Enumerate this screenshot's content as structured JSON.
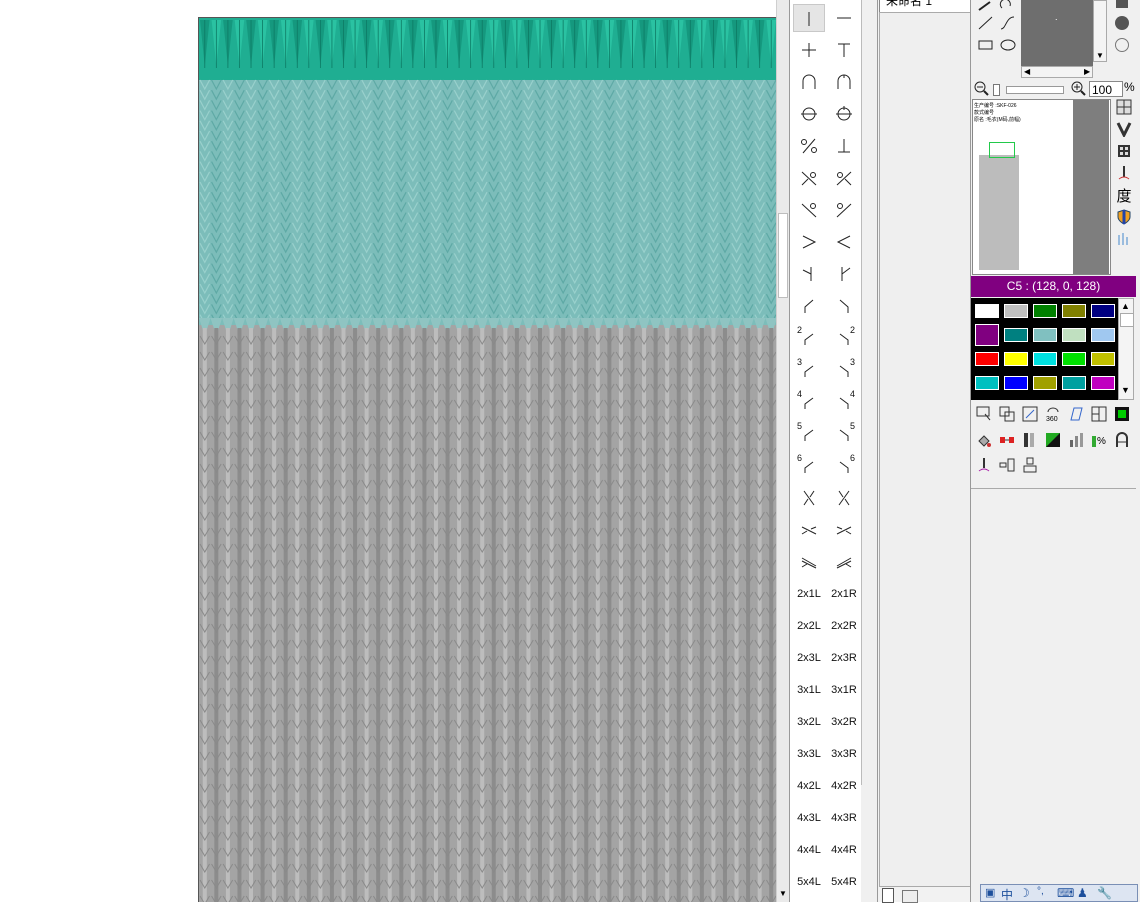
{
  "file_tab": {
    "title": "未命名 1"
  },
  "symbols": {
    "text_items": [
      "2x1L",
      "2x1R",
      "2x2L",
      "2x2R",
      "2x3L",
      "2x3R",
      "3x1L",
      "3x1R",
      "3x2L",
      "3x2R",
      "3x3L",
      "3x3R",
      "4x2L",
      "4x2R",
      "4x3L",
      "4x3R",
      "4x4L",
      "4x4R",
      "5x4L",
      "5x4R"
    ],
    "numbered_cross": [
      "2",
      "2",
      "3",
      "3",
      "4",
      "4",
      "5",
      "5",
      "6",
      "6"
    ]
  },
  "zoom": {
    "value": "100",
    "unit": "%"
  },
  "thumbnail": {
    "line1": "生产编号 :SKF-026",
    "line2": "款式编号",
    "line3": "原名 :毛衣(M码,前幅)"
  },
  "side_icons": {
    "degree": "度"
  },
  "current_color": {
    "label": "C5 : (128, 0, 128)",
    "hex": "#800080"
  },
  "palette": [
    "#ffffff",
    "#c0c0c0",
    "#008000",
    "#808000",
    "#000080",
    "#800080",
    "#008080",
    "#80c0c0",
    "#c0e0c0",
    "#a0c8f0",
    "#ff0000",
    "#ffff00",
    "#00e0e0",
    "#00e000",
    "#c0c000",
    "#00c0c0",
    "#0000ff",
    "#a0a000",
    "#00a0a0",
    "#c000c0"
  ],
  "canvas_colors": {
    "rib": "#1fae92",
    "body_top": "#7cbdba",
    "body_bottom": "#a4a4a4"
  },
  "status": {
    "ime_label": "中"
  }
}
